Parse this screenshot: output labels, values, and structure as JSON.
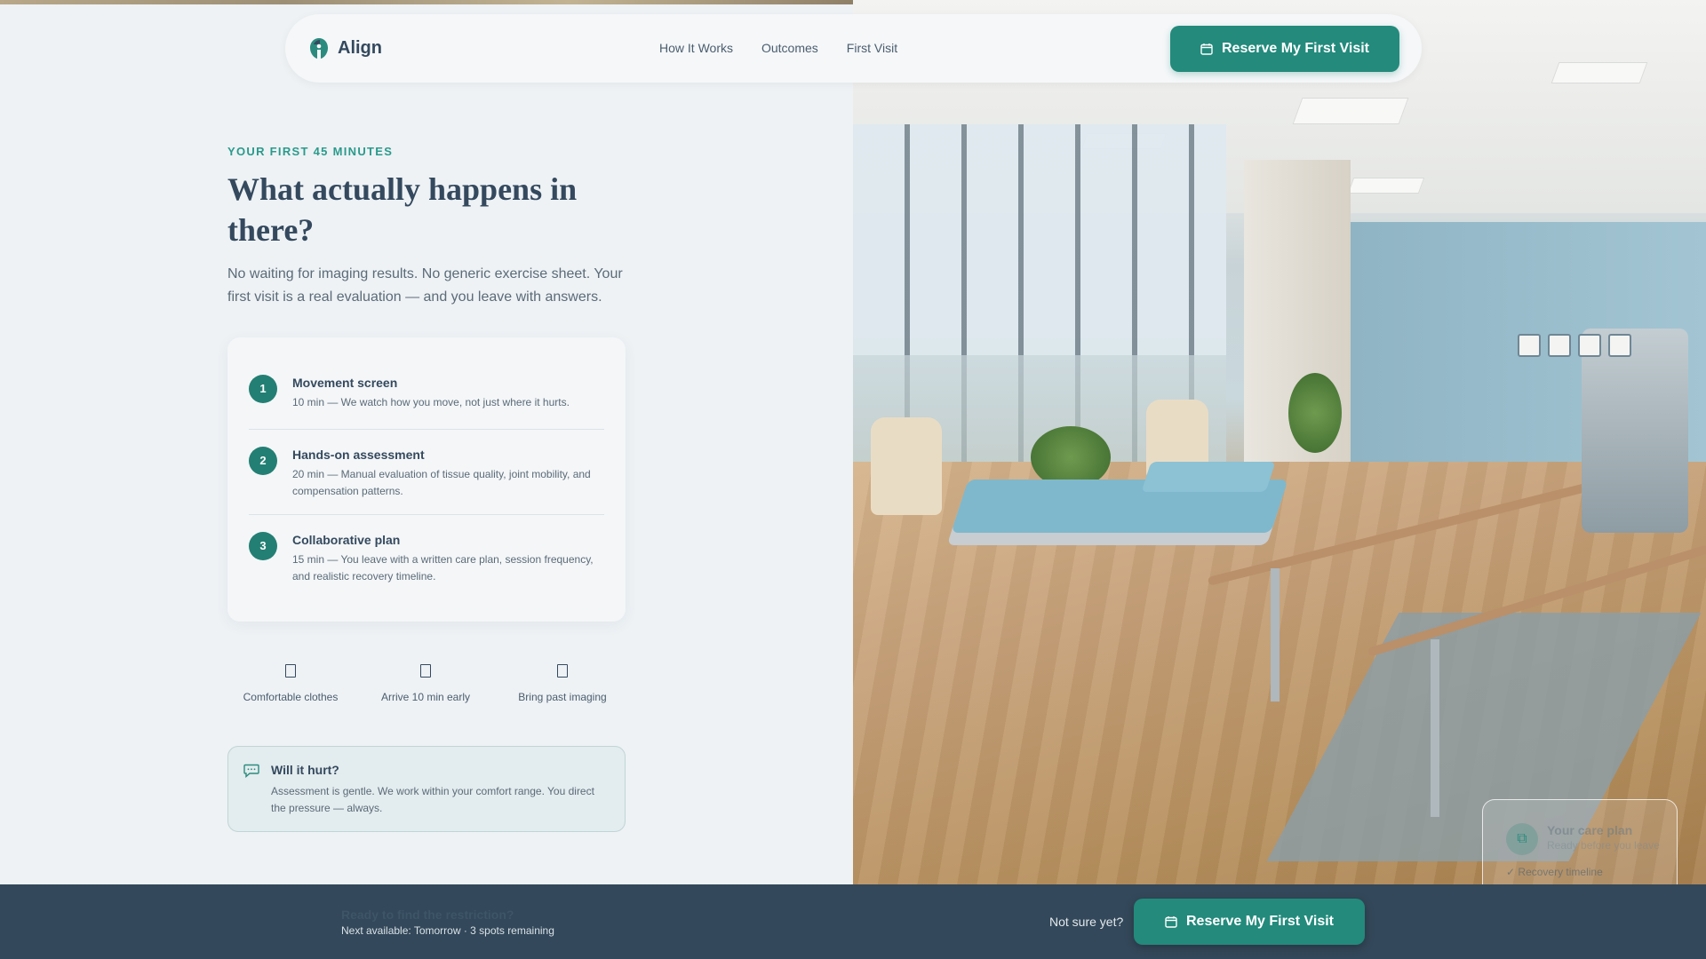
{
  "nav": {
    "brand": "Align",
    "links": [
      "How It Works",
      "Outcomes",
      "First Visit"
    ],
    "cta_label": "Reserve My First Visit"
  },
  "hero": {
    "eyebrow": "YOUR FIRST 45 MINUTES",
    "headline": "What actually happens in there?",
    "intro": "No waiting for imaging results. No generic exercise sheet. Your first visit is a real evaluation — and you leave with answers."
  },
  "steps": [
    {
      "number": "1",
      "title": "Movement screen",
      "desc": "10 min — We watch how you move, not just where it hurts."
    },
    {
      "number": "2",
      "title": "Hands-on assessment",
      "desc": "20 min — Manual evaluation of tissue quality, joint mobility, and compensation patterns."
    },
    {
      "number": "3",
      "title": "Collaborative plan",
      "desc": "15 min — You leave with a written care plan, session frequency, and realistic recovery timeline."
    }
  ],
  "prep": [
    {
      "icon": "shirt-icon",
      "label": "Comfortable clothes"
    },
    {
      "icon": "clock-icon",
      "label": "Arrive 10 min early"
    },
    {
      "icon": "file-icon",
      "label": "Bring past imaging"
    }
  ],
  "hurt": {
    "title": "Will it hurt?",
    "desc": "Assessment is gentle. We work within your comfort range. You direct the pressure — always."
  },
  "care_card": {
    "title": "Your care plan",
    "subtitle": "Ready before you leave",
    "row": "Recovery timeline"
  },
  "bottom_bar": {
    "title": "Ready to find the restriction?",
    "subtitle": "Next available: Tomorrow · 3 spots remaining",
    "not_sure": "Not sure yet?",
    "cta_label": "Reserve My First Visit"
  },
  "colors": {
    "accent": "#238a7c",
    "eyebrow": "#2a9a8b",
    "heading": "#34495e",
    "bar_bg": "#33485a",
    "page_bg": "#eef2f5"
  }
}
